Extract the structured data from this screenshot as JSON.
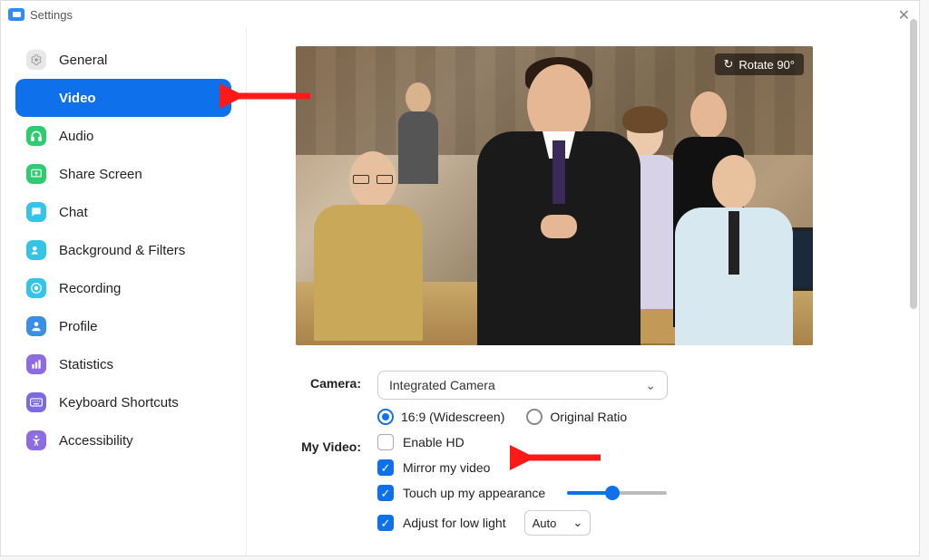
{
  "window": {
    "title": "Settings"
  },
  "sidebar": {
    "items": [
      {
        "label": "General"
      },
      {
        "label": "Video"
      },
      {
        "label": "Audio"
      },
      {
        "label": "Share Screen"
      },
      {
        "label": "Chat"
      },
      {
        "label": "Background & Filters"
      },
      {
        "label": "Recording"
      },
      {
        "label": "Profile"
      },
      {
        "label": "Statistics"
      },
      {
        "label": "Keyboard Shortcuts"
      },
      {
        "label": "Accessibility"
      }
    ],
    "active_index": 1
  },
  "preview": {
    "rotate_label": "Rotate 90°"
  },
  "form": {
    "camera_label": "Camera:",
    "camera_selected": "Integrated Camera",
    "ratio_widescreen": "16:9 (Widescreen)",
    "ratio_original": "Original Ratio",
    "ratio_selected": "widescreen",
    "my_video_label": "My Video:",
    "enable_hd": {
      "label": "Enable HD",
      "checked": false
    },
    "mirror": {
      "label": "Mirror my video",
      "checked": true
    },
    "touchup": {
      "label": "Touch up my appearance",
      "checked": true,
      "slider_value": 45
    },
    "lowlight": {
      "label": "Adjust for low light",
      "checked": true,
      "mode": "Auto"
    }
  },
  "colors": {
    "accent": "#0e71eb"
  }
}
